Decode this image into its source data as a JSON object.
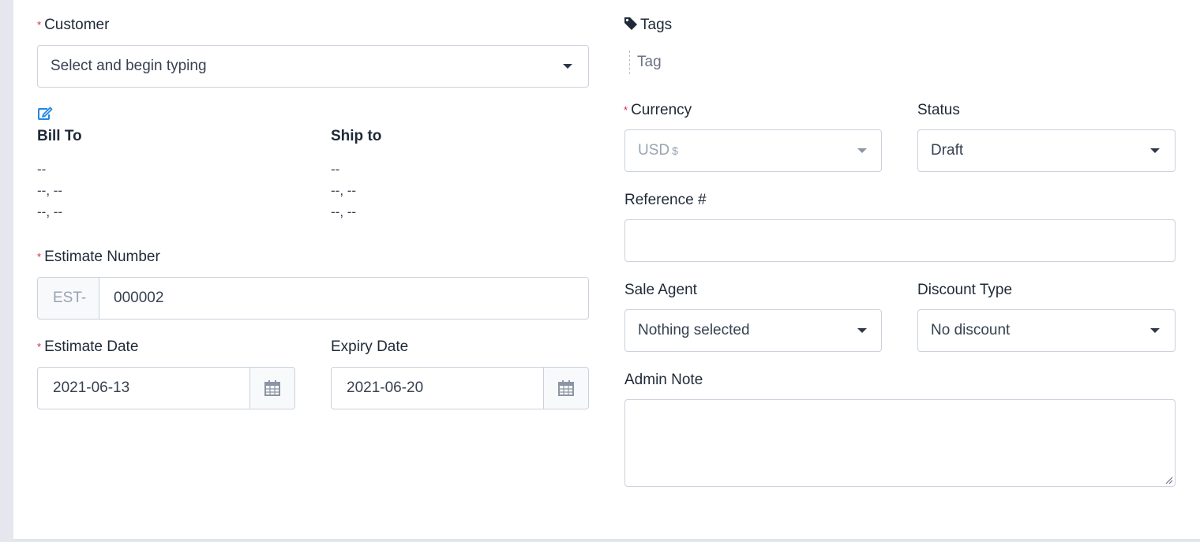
{
  "customer": {
    "label": "Customer",
    "placeholder": "Select and begin typing"
  },
  "bill_to": {
    "heading": "Bill To",
    "line1": "--",
    "line2": "--, --",
    "line3": "--, --"
  },
  "ship_to": {
    "heading": "Ship to",
    "line1": "--",
    "line2": "--, --",
    "line3": "--, --"
  },
  "estimate_number": {
    "label": "Estimate Number",
    "prefix": "EST-",
    "value": "000002"
  },
  "estimate_date": {
    "label": "Estimate Date",
    "value": "2021-06-13"
  },
  "expiry_date": {
    "label": "Expiry Date",
    "value": "2021-06-20"
  },
  "tags": {
    "label": "Tags",
    "placeholder": "Tag"
  },
  "currency": {
    "label": "Currency",
    "value": "USD",
    "symbol": "$"
  },
  "status": {
    "label": "Status",
    "value": "Draft"
  },
  "reference": {
    "label": "Reference #",
    "value": ""
  },
  "sale_agent": {
    "label": "Sale Agent",
    "value": "Nothing selected"
  },
  "discount_type": {
    "label": "Discount Type",
    "value": "No discount"
  },
  "admin_note": {
    "label": "Admin Note",
    "value": ""
  },
  "required_marker": "*",
  "icons": {
    "edit": "edit-icon",
    "tag": "tag-icon",
    "calendar": "calendar-icon",
    "dropdown": "chevron-down-icon"
  },
  "colors": {
    "required": "#e11d48",
    "link": "#1e88e5",
    "border": "#cbd2dc"
  }
}
